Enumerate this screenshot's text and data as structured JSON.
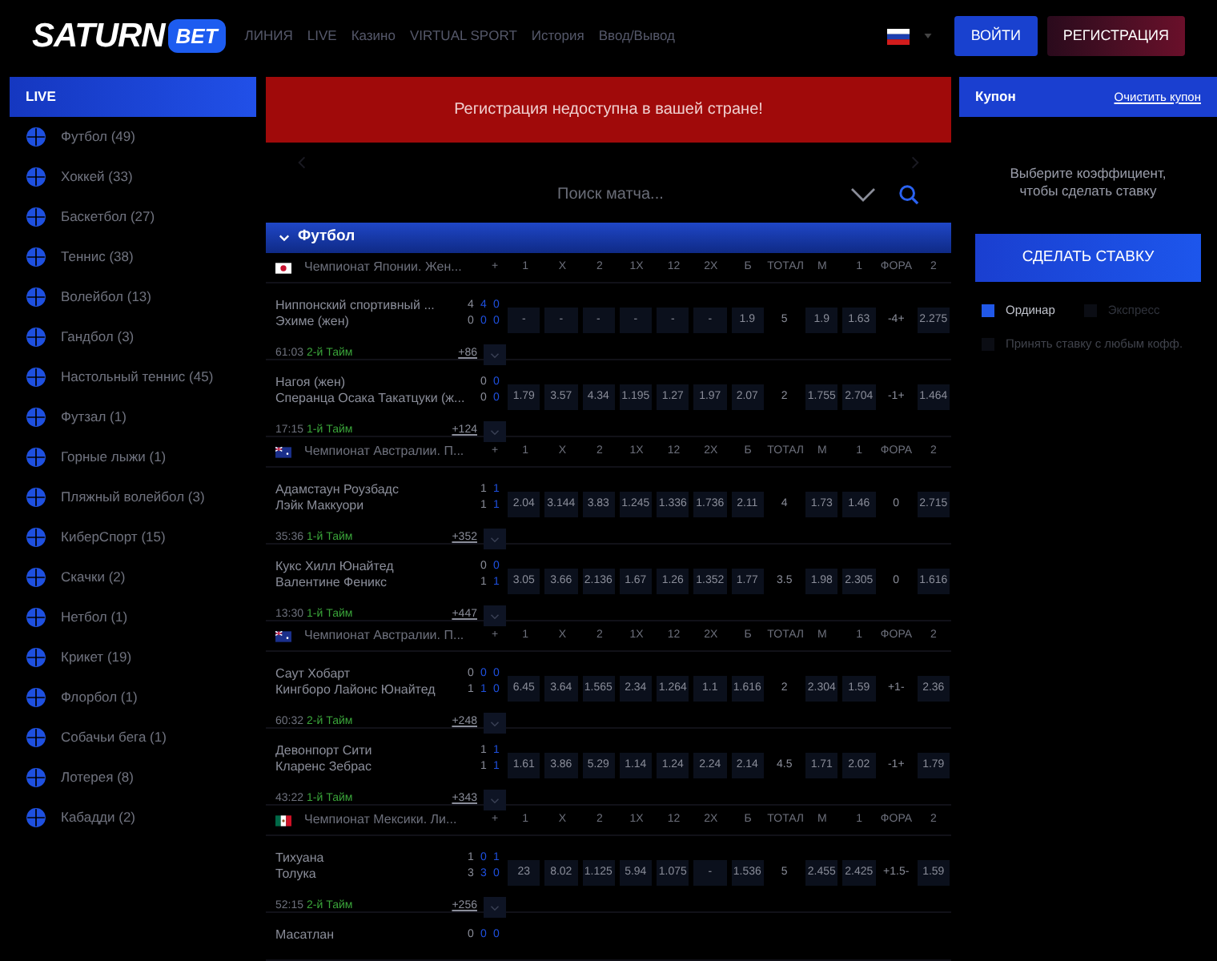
{
  "header": {
    "logo": {
      "text": "SATURN",
      "badge": "BET"
    },
    "nav": [
      "ЛИНИЯ",
      "LIVE",
      "Казино",
      "VIRTUAL SPORT",
      "История",
      "Ввод/Вывод"
    ],
    "login_button": "ВОЙТИ",
    "register_button": "РЕГИСТРАЦИЯ"
  },
  "sidebar": {
    "title": "LIVE",
    "items": [
      {
        "label": "Футбол (49)"
      },
      {
        "label": "Хоккей (33)"
      },
      {
        "label": "Баскетбол (27)"
      },
      {
        "label": "Теннис (38)"
      },
      {
        "label": "Волейбол (13)"
      },
      {
        "label": "Гандбол (3)"
      },
      {
        "label": "Настольный теннис (45)"
      },
      {
        "label": "Футзал (1)"
      },
      {
        "label": "Горные лыжи (1)"
      },
      {
        "label": "Пляжный волейбол (3)"
      },
      {
        "label": "КиберСпорт (15)"
      },
      {
        "label": "Скачки (2)"
      },
      {
        "label": "Нетбол (1)"
      },
      {
        "label": "Крикет (19)"
      },
      {
        "label": "Флорбол (1)"
      },
      {
        "label": "Собачьи бега (1)"
      },
      {
        "label": "Лотерея (8)"
      },
      {
        "label": "Кабадди (2)"
      }
    ]
  },
  "notice": "Регистрация недоступна в вашей стране!",
  "search": {
    "placeholder": "Поиск матча..."
  },
  "section": {
    "title": "Футбол",
    "expanded": true
  },
  "leagues": [
    {
      "kind": "japan",
      "name": "Чемпионат Японии. Жен...",
      "columns": [
        "+",
        "1",
        "X",
        "2",
        "1X",
        "12",
        "2X",
        "Б",
        "ТОТАЛ",
        "М",
        "1",
        "ФОРА",
        "2"
      ],
      "matches": [
        {
          "team_1": "Ниппонский спортивный ...",
          "team_2": "Эхиме (жен)",
          "scores_1": [
            "4",
            "4",
            "0"
          ],
          "scores_2": [
            "0",
            "0",
            "0"
          ],
          "odds": [
            "-",
            "-",
            "-",
            "-",
            "-",
            "-",
            "1.9",
            "5",
            "1.9",
            "1.63",
            "-4+",
            "2.275"
          ],
          "time": "61:03",
          "period": "2-й Тайм",
          "more": "+86"
        },
        {
          "team_1": "Нагоя (жен)",
          "team_2": "Сперанца Осака Такатцуки (ж...",
          "scores_1": [
            "0",
            "0"
          ],
          "scores_2": [
            "0",
            "0"
          ],
          "odds": [
            "1.79",
            "3.57",
            "4.34",
            "1.195",
            "1.27",
            "1.97",
            "2.07",
            "2",
            "1.755",
            "2.704",
            "-1+",
            "1.464"
          ],
          "time": "17:15",
          "period": "1-й Тайм",
          "more": "+124"
        }
      ]
    },
    {
      "kind": "australia",
      "name": "Чемпионат Австралии. П...",
      "columns": [
        "+",
        "1",
        "X",
        "2",
        "1X",
        "12",
        "2X",
        "Б",
        "ТОТАЛ",
        "М",
        "1",
        "ФОРА",
        "2"
      ],
      "matches": [
        {
          "team_1": "Адамстаун Роузбадс",
          "team_2": "Лэйк Маккуори",
          "scores_1": [
            "1",
            "1"
          ],
          "scores_2": [
            "1",
            "1"
          ],
          "odds": [
            "2.04",
            "3.144",
            "3.83",
            "1.245",
            "1.336",
            "1.736",
            "2.11",
            "4",
            "1.73",
            "1.46",
            "0",
            "2.715"
          ],
          "time": "35:36",
          "period": "1-й Тайм",
          "more": "+352"
        },
        {
          "team_1": "Кукс Хилл Юнайтед",
          "team_2": "Валентине Феникс",
          "scores_1": [
            "0",
            "0"
          ],
          "scores_2": [
            "1",
            "1"
          ],
          "odds": [
            "3.05",
            "3.66",
            "2.136",
            "1.67",
            "1.26",
            "1.352",
            "1.77",
            "3.5",
            "1.98",
            "2.305",
            "0",
            "1.616"
          ],
          "time": "13:30",
          "period": "1-й Тайм",
          "more": "+447"
        }
      ]
    },
    {
      "kind": "australia",
      "name": "Чемпионат Австралии. П...",
      "columns": [
        "+",
        "1",
        "X",
        "2",
        "1X",
        "12",
        "2X",
        "Б",
        "ТОТАЛ",
        "М",
        "1",
        "ФОРА",
        "2"
      ],
      "matches": [
        {
          "team_1": "Саут Хобарт",
          "team_2": "Кингборо Лайонс Юнайтед",
          "scores_1": [
            "0",
            "0",
            "0"
          ],
          "scores_2": [
            "1",
            "1",
            "0"
          ],
          "odds": [
            "6.45",
            "3.64",
            "1.565",
            "2.34",
            "1.264",
            "1.1",
            "1.616",
            "2",
            "2.304",
            "1.59",
            "+1-",
            "2.36"
          ],
          "time": "60:32",
          "period": "2-й Тайм",
          "more": "+248"
        },
        {
          "team_1": "Девонпорт Сити",
          "team_2": "Кларенс Зебрас",
          "scores_1": [
            "1",
            "1"
          ],
          "scores_2": [
            "1",
            "1"
          ],
          "odds": [
            "1.61",
            "3.86",
            "5.29",
            "1.14",
            "1.24",
            "2.24",
            "2.14",
            "4.5",
            "1.71",
            "2.02",
            "-1+",
            "1.79"
          ],
          "time": "43:22",
          "period": "1-й Тайм",
          "more": "+343"
        }
      ]
    },
    {
      "kind": "mexico",
      "name": "Чемпионат Мексики. Ли...",
      "columns": [
        "+",
        "1",
        "X",
        "2",
        "1X",
        "12",
        "2X",
        "Б",
        "ТОТАЛ",
        "М",
        "1",
        "ФОРА",
        "2"
      ],
      "matches": [
        {
          "team_1": "Тихуана",
          "team_2": "Толука",
          "scores_1": [
            "1",
            "0",
            "1"
          ],
          "scores_2": [
            "3",
            "3",
            "0"
          ],
          "odds": [
            "23",
            "8.02",
            "1.125",
            "5.94",
            "1.075",
            "-",
            "1.536",
            "5",
            "2.455",
            "2.425",
            "+1.5-",
            "1.59"
          ],
          "time": "52:15",
          "period": "2-й Тайм",
          "more": "+256"
        },
        {
          "team_1": "Масатлан",
          "scores_1": [
            "0",
            "0",
            "0"
          ]
        }
      ]
    }
  ],
  "coupon": {
    "title": "Купон",
    "clear_link": "Очистить купон",
    "hint": "Выберите коэффициент, чтобы сделать ставку",
    "bet_button": "СДЕЛАТЬ СТАВКУ",
    "bet_types": [
      {
        "label": "Ординар",
        "selected": true
      },
      {
        "label": "Экспресс",
        "selected": false
      }
    ],
    "accept_any": {
      "label": "Принять ставку с любым кофф.",
      "checked": false
    }
  }
}
